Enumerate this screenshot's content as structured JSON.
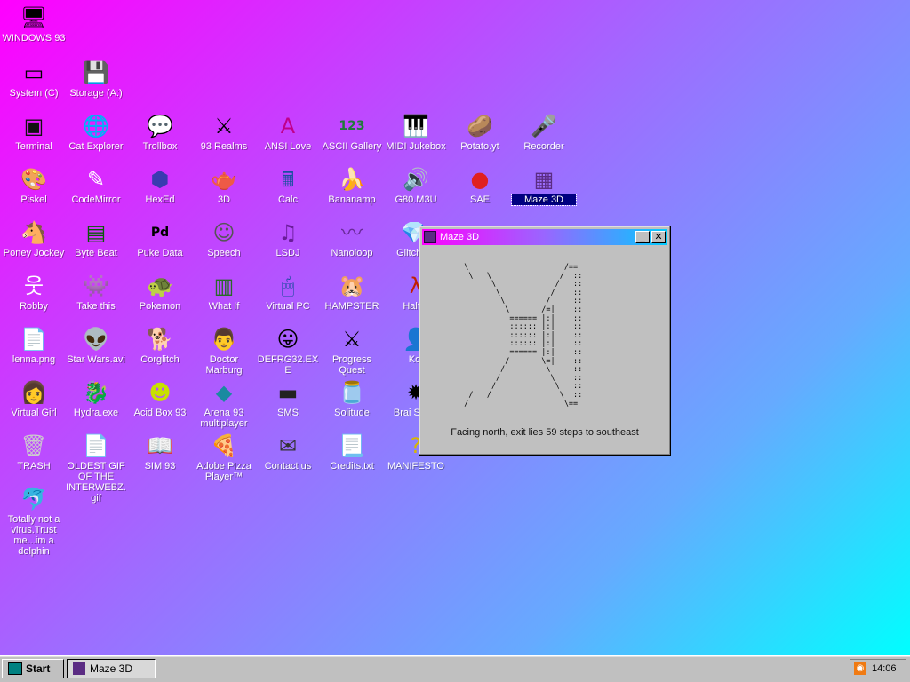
{
  "desktop": {
    "icons": [
      {
        "id": "windows93",
        "label": "WINDOWS 93",
        "glyph": "🖥",
        "icon": "computer-icon"
      },
      {
        "id": "system-c",
        "label": "System (C)",
        "glyph": "▭",
        "icon": "drive-icon"
      },
      {
        "id": "storage-a",
        "label": "Storage (A:)",
        "glyph": "💾",
        "icon": "floppy-icon"
      },
      {
        "id": "terminal",
        "label": "Terminal",
        "glyph": "▣",
        "icon": "terminal-icon"
      },
      {
        "id": "cat-explorer",
        "label": "Cat Explorer",
        "glyph": "🌐",
        "icon": "globe-icon"
      },
      {
        "id": "trollbox",
        "label": "Trollbox",
        "glyph": "💬",
        "icon": "chat-icon"
      },
      {
        "id": "93-realms",
        "label": "93 Realms",
        "glyph": "⚔",
        "icon": "knight-icon"
      },
      {
        "id": "ansi-love",
        "label": "ANSI Love",
        "glyph": "A",
        "icon": "ansi-icon"
      },
      {
        "id": "ascii-gallery",
        "label": "ASCII Gallery",
        "glyph": "123",
        "icon": "ascii-icon"
      },
      {
        "id": "midi-jukebox",
        "label": "MIDI Jukebox",
        "glyph": "🎹",
        "icon": "keyboard-icon"
      },
      {
        "id": "potato-yt",
        "label": "Potato.yt",
        "glyph": "🥔",
        "icon": "potato-icon"
      },
      {
        "id": "recorder",
        "label": "Recorder",
        "glyph": "🎤",
        "icon": "microphone-icon"
      },
      {
        "id": "piskel",
        "label": "Piskel",
        "glyph": "🎨",
        "icon": "palette-icon"
      },
      {
        "id": "codemirror",
        "label": "CodeMirror",
        "glyph": "✎",
        "icon": "codemirror-icon"
      },
      {
        "id": "hexed",
        "label": "HexEd",
        "glyph": "⬢",
        "icon": "hexed-icon"
      },
      {
        "id": "3d",
        "label": "3D",
        "glyph": "🫖",
        "icon": "teapot-icon"
      },
      {
        "id": "calc",
        "label": "Calc",
        "glyph": "🖩",
        "icon": "calculator-icon"
      },
      {
        "id": "bananamp",
        "label": "Bananamp",
        "glyph": "🍌",
        "icon": "banana-icon"
      },
      {
        "id": "g80m3u",
        "label": "G80.M3U",
        "glyph": "🔊",
        "icon": "speaker-icon"
      },
      {
        "id": "sae",
        "label": "SAE",
        "glyph": "●",
        "icon": "ball-icon"
      },
      {
        "id": "maze-3d",
        "label": "Maze 3D",
        "glyph": "▦",
        "icon": "maze-icon",
        "selected": true
      },
      {
        "id": "poney-jockey",
        "label": "Poney Jockey",
        "glyph": "🐴",
        "icon": "pony-icon"
      },
      {
        "id": "byte-beat",
        "label": "Byte Beat",
        "glyph": "▤",
        "icon": "bytebeat-icon"
      },
      {
        "id": "puke-data",
        "label": "Puke Data",
        "glyph": "Pd",
        "icon": "puredata-icon"
      },
      {
        "id": "speech",
        "label": "Speech",
        "glyph": "☺",
        "icon": "face-icon"
      },
      {
        "id": "lsdj",
        "label": "LSDJ",
        "glyph": "♫",
        "icon": "lsdj-icon"
      },
      {
        "id": "nanoloop",
        "label": "Nanoloop",
        "glyph": "〰",
        "icon": "wave-icon"
      },
      {
        "id": "glitch",
        "label": "Glitch G",
        "glyph": "💎",
        "icon": "gem-icon"
      },
      {
        "id": "robby",
        "label": "Robby",
        "glyph": "웃",
        "icon": "stickman-icon"
      },
      {
        "id": "take-this",
        "label": "Take this",
        "glyph": "👾",
        "icon": "pixel-man-icon"
      },
      {
        "id": "pokemon",
        "label": "Pokemon",
        "glyph": "🐢",
        "icon": "pokemon-icon"
      },
      {
        "id": "what-if",
        "label": "What If",
        "glyph": "▥",
        "icon": "whatif-icon"
      },
      {
        "id": "virtual-pc",
        "label": "Virtual PC",
        "glyph": "🖱",
        "icon": "virtual-pc-icon"
      },
      {
        "id": "hampster",
        "label": "HAMPSTER",
        "glyph": "🐹",
        "icon": "hamster-icon"
      },
      {
        "id": "half-life",
        "label": "Half-L",
        "glyph": "λ",
        "icon": "lambda-icon"
      },
      {
        "id": "lenna",
        "label": "lenna.png",
        "glyph": "📄",
        "icon": "image-file-icon"
      },
      {
        "id": "star-wars",
        "label": "Star Wars.avi",
        "glyph": "👽",
        "icon": "yoda-icon"
      },
      {
        "id": "corglitch",
        "label": "Corglitch",
        "glyph": "🐕",
        "icon": "corgi-icon"
      },
      {
        "id": "doctor-marburg",
        "label": "Doctor Marburg",
        "glyph": "👨",
        "icon": "doctor-icon"
      },
      {
        "id": "defrag",
        "label": "DEFRG32.EXE",
        "glyph": "😛",
        "icon": "defrag-icon"
      },
      {
        "id": "progress-quest",
        "label": "Progress Quest",
        "glyph": "⚔",
        "icon": "swords-icon"
      },
      {
        "id": "kof",
        "label": "Kof",
        "glyph": "👤",
        "icon": "kof-icon"
      },
      {
        "id": "virtual-girl",
        "label": "Virtual Girl",
        "glyph": "👩",
        "icon": "girl-icon"
      },
      {
        "id": "hydra",
        "label": "Hydra.exe",
        "glyph": "🐉",
        "icon": "dragon-icon"
      },
      {
        "id": "acid-box",
        "label": "Acid Box 93",
        "glyph": "☻",
        "icon": "smiley-icon"
      },
      {
        "id": "arena-93",
        "label": "Arena 93 multiplayer",
        "glyph": "◆",
        "icon": "cube-icon"
      },
      {
        "id": "sms",
        "label": "SMS",
        "glyph": "▬",
        "icon": "console-icon"
      },
      {
        "id": "solitude",
        "label": "Solitude",
        "glyph": "🫙",
        "icon": "jar-icon"
      },
      {
        "id": "brain-sweep",
        "label": "Brai Swee",
        "glyph": "✹",
        "icon": "mine-icon"
      },
      {
        "id": "trash",
        "label": "TRASH",
        "glyph": "🗑",
        "icon": "trash-icon"
      },
      {
        "id": "oldest-gif",
        "label": "OLDEST GIF OF THE INTERWEBZ.gif",
        "glyph": "📄",
        "icon": "gif-file-icon"
      },
      {
        "id": "sim93",
        "label": "SIM 93",
        "glyph": "📖",
        "icon": "book-icon"
      },
      {
        "id": "adobe-pizza",
        "label": "Adobe Pizza Player™",
        "glyph": "🍕",
        "icon": "pizza-icon"
      },
      {
        "id": "contact-us",
        "label": "Contact us",
        "glyph": "✉",
        "icon": "contact-icon"
      },
      {
        "id": "credits",
        "label": "Credits.txt",
        "glyph": "📃",
        "icon": "text-file-icon"
      },
      {
        "id": "manifesto",
        "label": "MANIFESTO",
        "glyph": "?",
        "icon": "question-icon"
      },
      {
        "id": "dolphin",
        "label": "Totally not a virus.Trust me...im a dolphin",
        "glyph": "🐬",
        "icon": "dolphin-icon"
      }
    ]
  },
  "window": {
    "title": "Maze 3D",
    "minimize_glyph": "_",
    "close_glyph": "✕",
    "maze_ascii": "  \\                     /==\n   \\   \\               / |::\n        \\             /  |::\n         \\           /   |::\n          \\         /    |::\n           \\       /=|   |::\n            ====== |:|   |::\n            :::::: |:|   |::\n            :::::: |:|   |::\n            :::::: |:|   |::\n            ====== |:|   |::\n           /       \\=|   |::\n          /         \\    |::\n         /           \\   |::\n        /             \\  |::\n   /   /               \\ |::\n  /                     \\==",
    "status": "Facing north, exit lies 59 steps to southeast"
  },
  "taskbar": {
    "start_label": "Start",
    "task_label": "Maze 3D",
    "clock": "14:06",
    "rss_glyph": "◉"
  }
}
